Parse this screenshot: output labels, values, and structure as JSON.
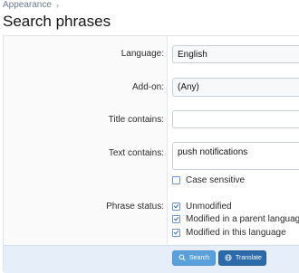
{
  "breadcrumb": {
    "item": "Appearance"
  },
  "page_title": "Search phrases",
  "form": {
    "language": {
      "label": "Language:",
      "value": "English"
    },
    "addon": {
      "label": "Add-on:",
      "value": "(Any)"
    },
    "title_contains": {
      "label": "Title contains:",
      "value": ""
    },
    "text_contains": {
      "label": "Text contains:",
      "value": "push notifications"
    },
    "case_sensitive": {
      "label": "Case sensitive",
      "checked": false
    },
    "phrase_status": {
      "label": "Phrase status:",
      "options": [
        {
          "label": "Unmodified",
          "checked": true
        },
        {
          "label": "Modified in a parent language",
          "checked": true
        },
        {
          "label": "Modified in this language",
          "checked": true
        }
      ]
    }
  },
  "buttons": {
    "search": {
      "label": "Search",
      "icon": "search-icon"
    },
    "translate": {
      "label": "Translate",
      "icon": "globe-icon"
    }
  },
  "colors": {
    "search_button": "#5aa0db",
    "translate_button": "#2d6aa9",
    "footer": "#e6eff9"
  }
}
